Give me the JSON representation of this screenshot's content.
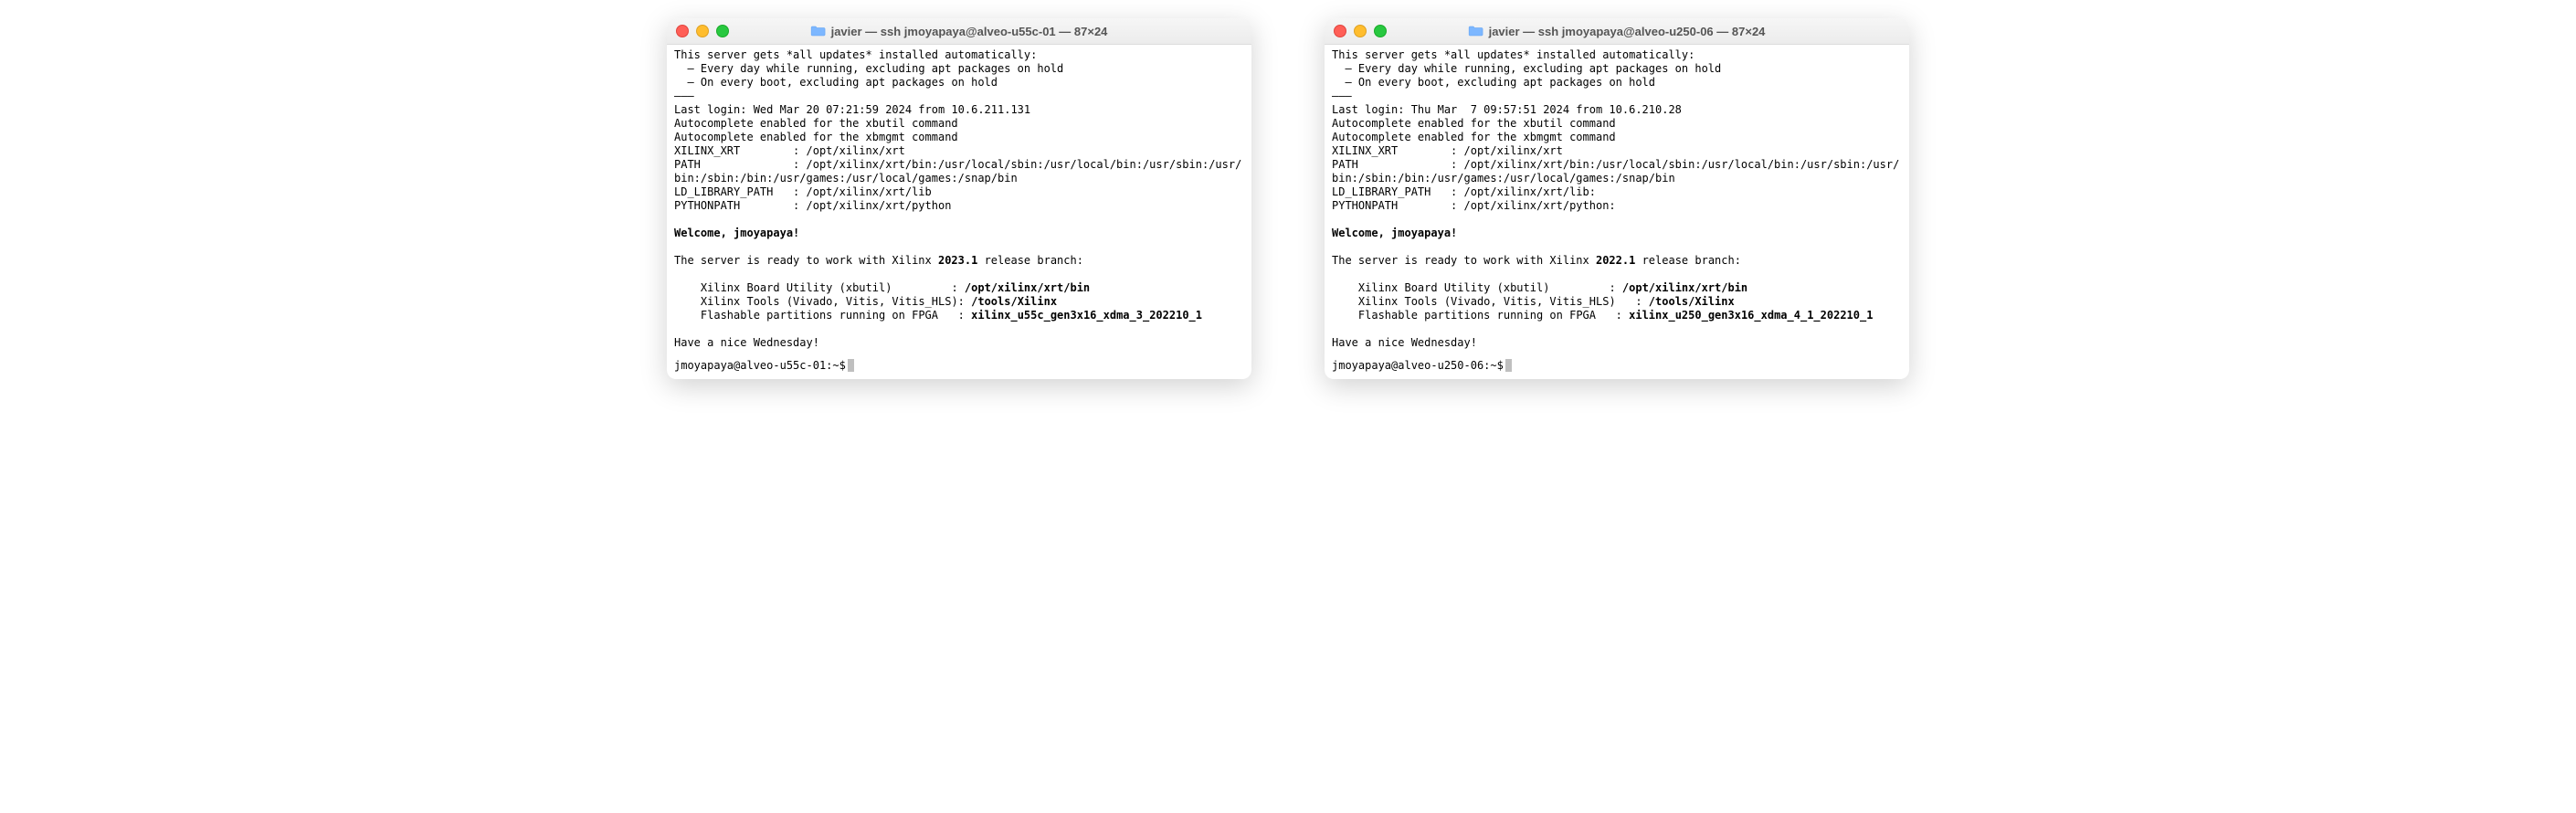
{
  "terminals": [
    {
      "title": "javier — ssh jmoyapaya@alveo-u55c-01 — 87×24",
      "motd_header": "This server gets *all updates* installed automatically:",
      "motd_b1": "  – Every day while running, excluding apt packages on hold",
      "motd_b2": "  – On every boot, excluding apt packages on hold",
      "sep": "———",
      "last_login": "Last login: Wed Mar 20 07:21:59 2024 from 10.6.211.131",
      "auto1": "Autocomplete enabled for the xbutil command",
      "auto2": "Autocomplete enabled for the xbmgmt command",
      "xrt": "XILINX_XRT        : /opt/xilinx/xrt",
      "path": "PATH              : /opt/xilinx/xrt/bin:/usr/local/sbin:/usr/local/bin:/usr/sbin:/usr/bin:/sbin:/bin:/usr/games:/usr/local/games:/snap/bin",
      "ldlib": "LD_LIBRARY_PATH   : /opt/xilinx/xrt/lib",
      "pythonpath": "PYTHONPATH        : /opt/xilinx/xrt/python",
      "welcome": "Welcome, jmoyapaya!",
      "ready_pre": "The server is ready to work with Xilinx ",
      "ready_ver": "2023.1",
      "ready_post": " release branch:",
      "util_label": "    Xilinx Board Utility (xbutil)         : ",
      "util_val": "/opt/xilinx/xrt/bin",
      "tools_label": "    Xilinx Tools (Vivado, Vitis, Vitis_HLS): ",
      "tools_val": "/tools/Xilinx",
      "flash_label": "    Flashable partitions running on FPGA   : ",
      "flash_val": "xilinx_u55c_gen3x16_xdma_3_202210_1",
      "farewell": "Have a nice Wednesday!",
      "prompt": "jmoyapaya@alveo-u55c-01:~$ "
    },
    {
      "title": "javier — ssh jmoyapaya@alveo-u250-06 — 87×24",
      "motd_header": "This server gets *all updates* installed automatically:",
      "motd_b1": "  – Every day while running, excluding apt packages on hold",
      "motd_b2": "  – On every boot, excluding apt packages on hold",
      "sep": "———",
      "last_login": "Last login: Thu Mar  7 09:57:51 2024 from 10.6.210.28",
      "auto1": "Autocomplete enabled for the xbutil command",
      "auto2": "Autocomplete enabled for the xbmgmt command",
      "xrt": "XILINX_XRT        : /opt/xilinx/xrt",
      "path": "PATH              : /opt/xilinx/xrt/bin:/usr/local/sbin:/usr/local/bin:/usr/sbin:/usr/bin:/sbin:/bin:/usr/games:/usr/local/games:/snap/bin",
      "ldlib": "LD_LIBRARY_PATH   : /opt/xilinx/xrt/lib:",
      "pythonpath": "PYTHONPATH        : /opt/xilinx/xrt/python:",
      "welcome": "Welcome, jmoyapaya!",
      "ready_pre": "The server is ready to work with Xilinx ",
      "ready_ver": "2022.1",
      "ready_post": " release branch:",
      "util_label": "    Xilinx Board Utility (xbutil)         : ",
      "util_val": "/opt/xilinx/xrt/bin",
      "tools_label": "    Xilinx Tools (Vivado, Vitis, Vitis_HLS)   : ",
      "tools_val": "/tools/Xilinx",
      "flash_label": "    Flashable partitions running on FPGA   : ",
      "flash_val": "xilinx_u250_gen3x16_xdma_4_1_202210_1",
      "farewell": "Have a nice Wednesday!",
      "prompt": "jmoyapaya@alveo-u250-06:~$ "
    }
  ]
}
